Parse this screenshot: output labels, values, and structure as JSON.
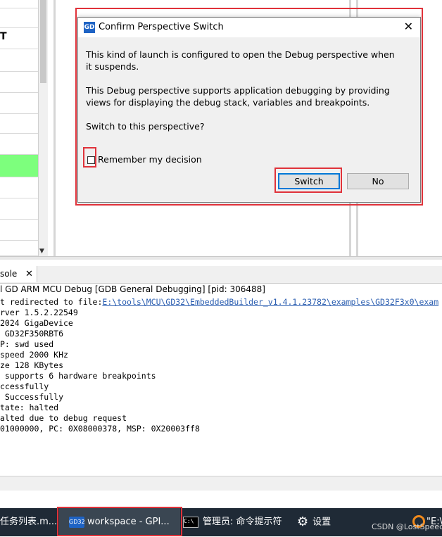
{
  "background": {
    "table_row_fragment": "T"
  },
  "dialog": {
    "app_icon": "GD",
    "title": "Confirm Perspective Switch",
    "close": "✕",
    "message1": "This kind of launch is configured to open the Debug perspective when it suspends.",
    "message2": "This Debug perspective supports application debugging by providing views for displaying the debug stack, variables and breakpoints.",
    "question": "Switch to this perspective?",
    "remember_label": "Remember my decision",
    "remember_checked": false,
    "switch_label": "Switch",
    "no_label": "No"
  },
  "console": {
    "tab_label": "sole",
    "tab_close": "✕",
    "title": "l GD ARM MCU Debug [GDB General Debugging]  [pid: 306488]",
    "redirect_prefix": "t redirected to file:",
    "redirect_link": "E:\\tools\\MCU\\GD32\\EmbeddedBuilder_v1.4.1.23782\\examples\\GD32F3x0\\exam",
    "lines": [
      "rver 1.5.2.22549",
      "2024 GigaDevice",
      " GD32F350RBT6",
      "P: swd used",
      "speed 2000 KHz",
      "ze 128 KBytes",
      " supports 6 hardware breakpoints",
      "ccessfully",
      " Successfully",
      "tate: halted",
      "alted due to debug request",
      "01000000, PC: 0X08000378, MSP: 0X20003ff8"
    ]
  },
  "taskbar": {
    "item1": "任务列表.m...",
    "gd_badge": "GD32",
    "item2": "workspace - GPI...",
    "cmd_glyph": "C:\\",
    "item3": "管理员: 命令提示符",
    "item4": "设置",
    "watermark": "CSDN @LostSpeed",
    "edge_text": "\"E:\\"
  },
  "colors": {
    "highlight": "#e0323a",
    "green_row": "#7dff7d",
    "taskbar": "#1f2a36",
    "link": "#2a5db0"
  }
}
